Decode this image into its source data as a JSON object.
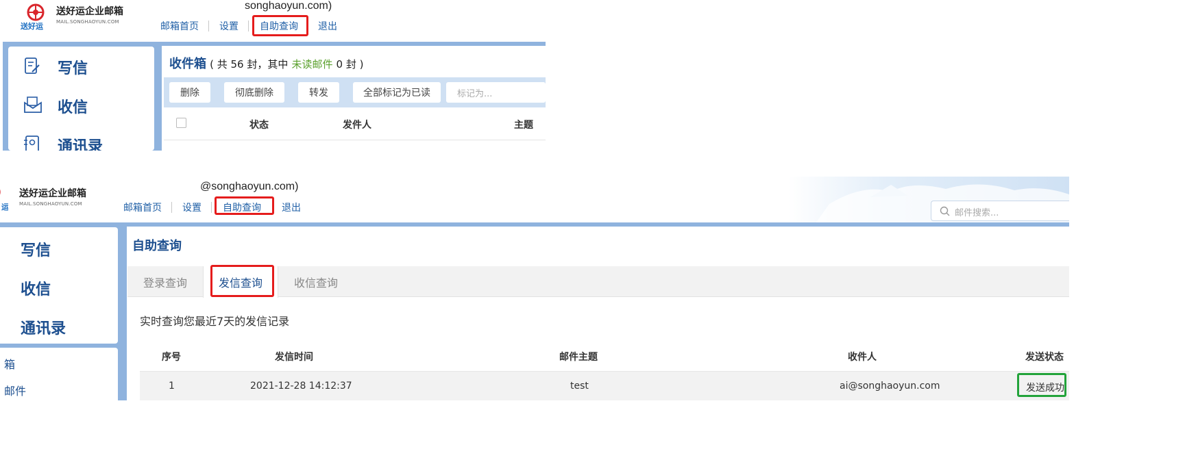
{
  "brand": {
    "title": "送好运企业邮箱",
    "subtitle": "MAIL.SONGHAOYUN.COM",
    "tag": "送好运",
    "accent": "#1f5fa6",
    "highlight_red": "#e51c1c",
    "highlight_green": "#22a33a"
  },
  "top": {
    "email_suffix": "songhaoyun.com)",
    "nav": {
      "home": "邮箱首页",
      "settings": "设置",
      "self_query": "自助查询",
      "logout": "退出"
    },
    "sidebar": {
      "compose": "写信",
      "receive": "收信",
      "contacts": "通讯录"
    },
    "inbox": {
      "title": "收件箱",
      "summary_prefix": "( 共 56 封，其中",
      "unread_label": "未读邮件",
      "summary_suffix": "0 封 )"
    },
    "toolbar": {
      "delete": "删除",
      "purge": "彻底删除",
      "forward": "转发",
      "mark_all_read": "全部标记为已读",
      "mark_as_placeholder": "标记为..."
    },
    "table_headers": {
      "status": "状态",
      "sender": "发件人",
      "subject": "主题"
    }
  },
  "bottom": {
    "email_suffix": "@songhaoyun.com)",
    "nav": {
      "home": "邮箱首页",
      "settings": "设置",
      "self_query": "自助查询",
      "logout": "退出"
    },
    "search": {
      "placeholder": "邮件搜索..."
    },
    "sidebar": {
      "compose": "写信",
      "receive": "收信",
      "contacts": "通讯录",
      "folder_1": "箱",
      "folder_2": "邮件"
    },
    "page_title": "自助查询",
    "tabs": {
      "login": "登录查询",
      "send": "发信查询",
      "receive": "收信查询"
    },
    "description": "实时查询您最近7天的发信记录",
    "table": {
      "headers": {
        "index": "序号",
        "time": "发信时间",
        "subject": "邮件主题",
        "recipient": "收件人",
        "status": "发送状态"
      },
      "rows": [
        {
          "index": "1",
          "time": "2021-12-28 14:12:37",
          "subject": "test",
          "recipient": "ai@songhaoyun.com",
          "status": "发送成功"
        }
      ]
    }
  }
}
